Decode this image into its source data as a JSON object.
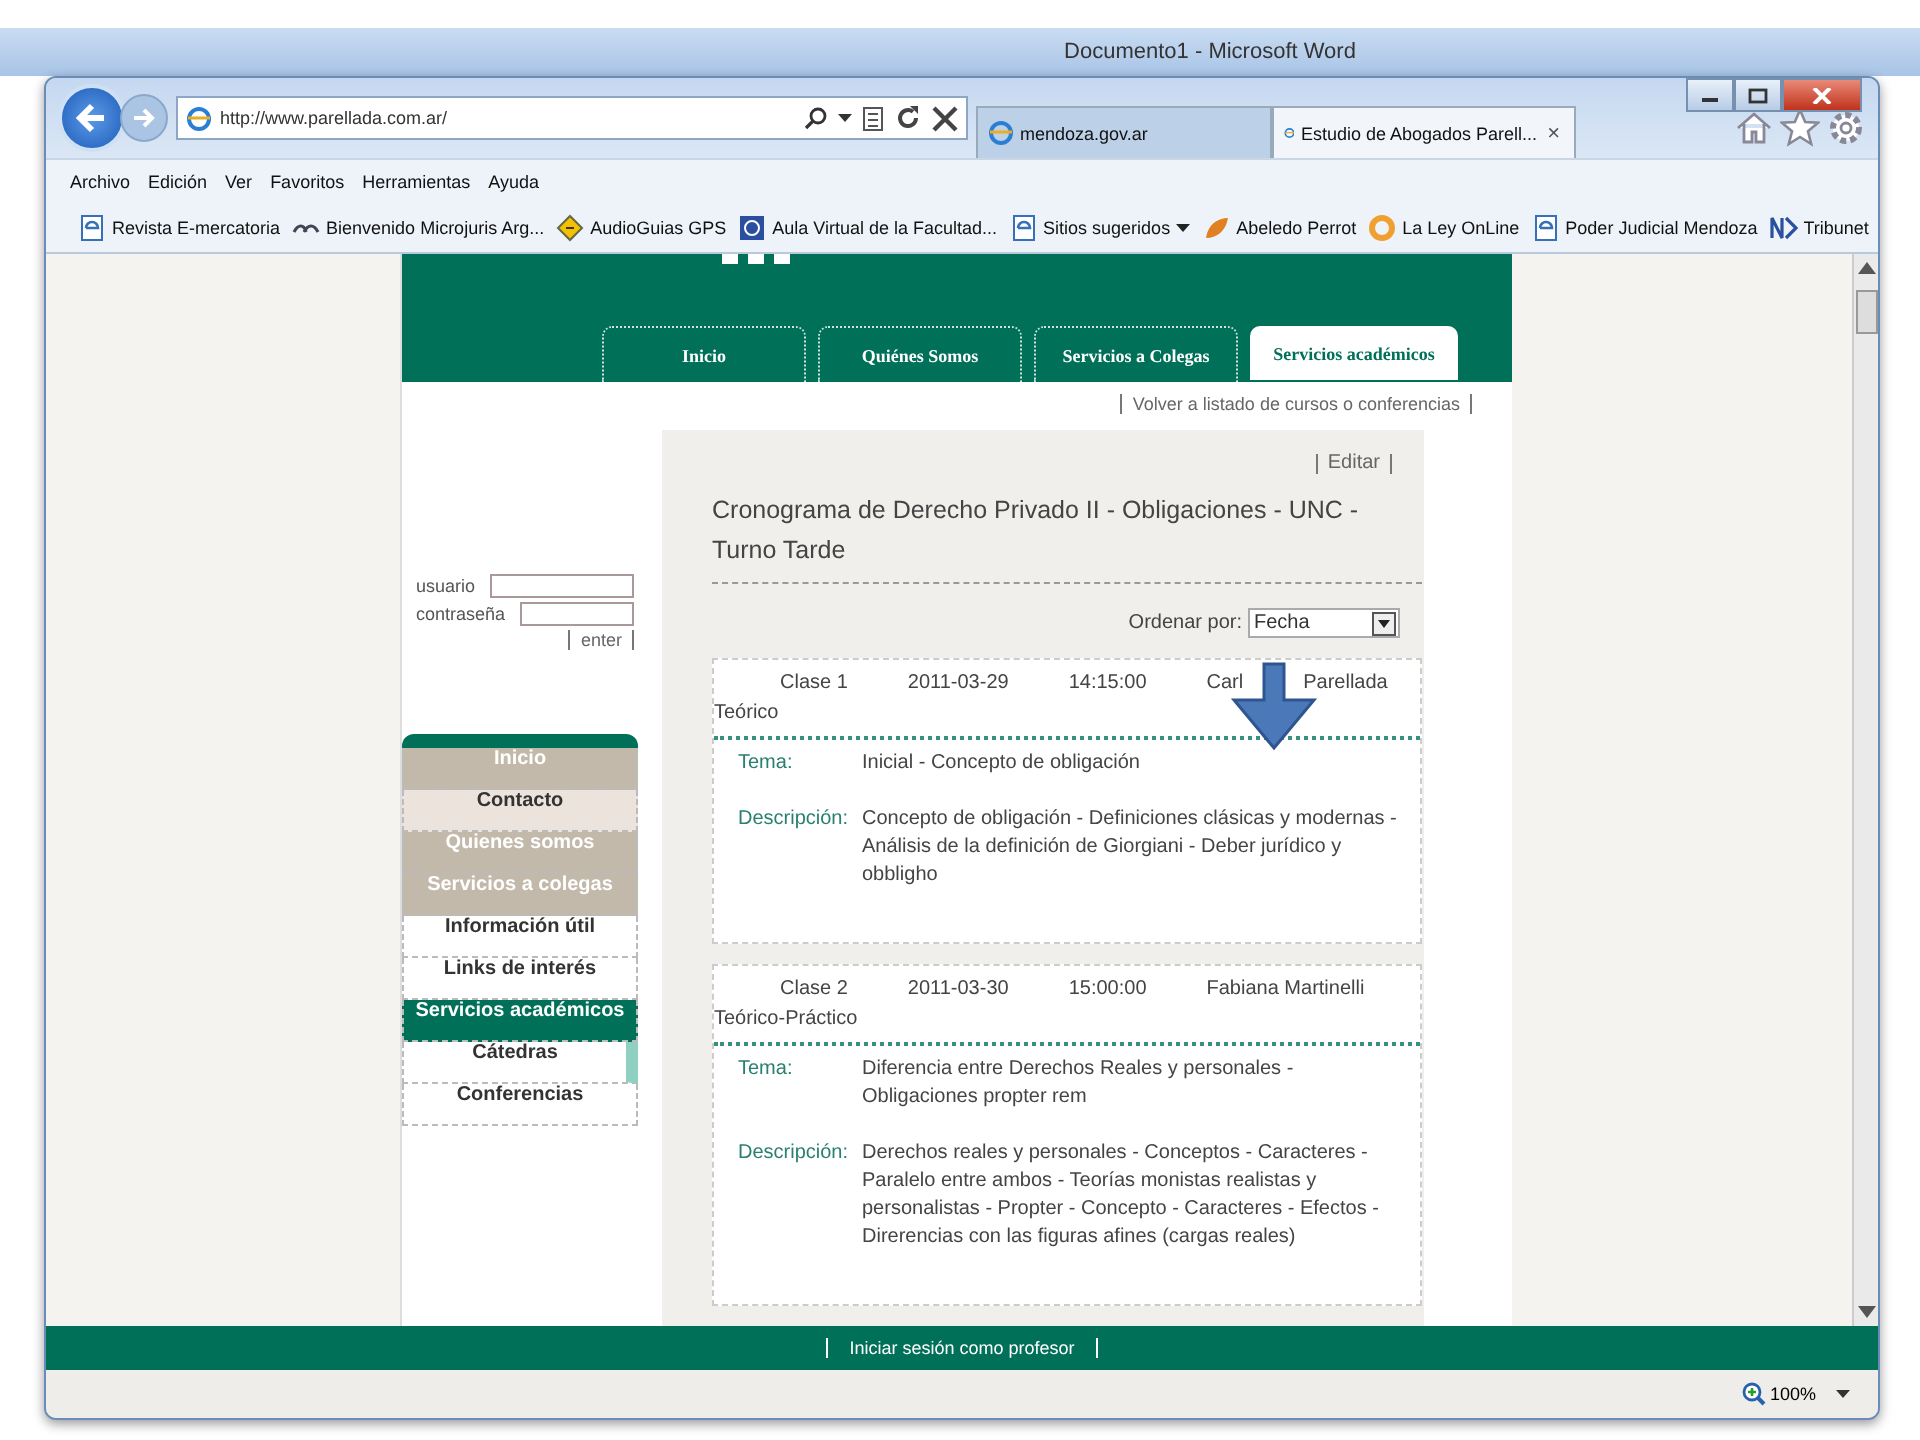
{
  "word_window": {
    "title": "Documento1 - Microsoft Word"
  },
  "browser": {
    "address": "http://www.parellada.com.ar/",
    "tabs": [
      {
        "label": "mendoza.gov.ar",
        "selected": false
      },
      {
        "label": "Estudio de Abogados Parell...",
        "selected": true,
        "close": "×"
      }
    ],
    "menu": [
      "Archivo",
      "Edición",
      "Ver",
      "Favoritos",
      "Herramientas",
      "Ayuda"
    ],
    "favorites": [
      {
        "label": "Revista E-mercatoria",
        "kind": "page"
      },
      {
        "label": "Bienvenido Microjuris Arg...",
        "kind": "mj"
      },
      {
        "label": "AudioGuias GPS",
        "kind": "diamond"
      },
      {
        "label": "Aula Virtual de la Facultad...",
        "kind": "square"
      },
      {
        "label": "Sitios sugeridos",
        "kind": "page",
        "dropdown": true
      },
      {
        "label": "Abeledo Perrot",
        "kind": "leaf"
      },
      {
        "label": "La Ley OnLine",
        "kind": "ring"
      },
      {
        "label": "Poder Judicial Mendoza",
        "kind": "page"
      },
      {
        "label": "Tribunet",
        "kind": "tn"
      }
    ],
    "zoom": "100%"
  },
  "site": {
    "nav_tabs": [
      {
        "label": "Inicio",
        "selected": false
      },
      {
        "label": "Quiénes Somos",
        "selected": false
      },
      {
        "label": "Servicios a Colegas",
        "selected": false
      },
      {
        "label": "Servicios académicos",
        "selected": true
      }
    ],
    "back_link": "Volver a listado de cursos o conferencias",
    "login": {
      "user_label": "usuario",
      "password_label": "contraseña",
      "enter": "enter"
    },
    "side_menu": [
      {
        "label": "Inicio",
        "kind": "main",
        "selected": false
      },
      {
        "label": "Contacto",
        "kind": "light",
        "selected": false
      },
      {
        "label": "Quienes somos",
        "kind": "main",
        "selected": false
      },
      {
        "label": "Servicios a colegas",
        "kind": "main",
        "selected": false
      },
      {
        "label": "Información útil",
        "kind": "plain",
        "selected": false
      },
      {
        "label": "Links de interés",
        "kind": "plain",
        "selected": false
      },
      {
        "label": "Servicios académicos",
        "kind": "plain",
        "selected": true
      },
      {
        "label": "Cátedras",
        "kind": "sub",
        "selected": false
      },
      {
        "label": "Conferencias",
        "kind": "plain",
        "selected": false
      }
    ],
    "edit_link": "Editar",
    "title": "Cronograma de Derecho Privado II - Obligaciones - UNC - Turno Tarde",
    "sort": {
      "label": "Ordenar por:",
      "value": "Fecha"
    },
    "classes": [
      {
        "fields": [
          "Clase 1",
          "2011-03-29",
          "14:15:00",
          "Carl",
          "Parellada",
          "Teórico"
        ],
        "topic_label": "Tema:",
        "topic": "Inicial - Concepto de obligación",
        "description_label": "Descripción:",
        "description": "Concepto de obligación - Definiciones clásicas y modernas - Análisis de la definición de Giorgiani - Deber jurídico y obbligho"
      },
      {
        "fields": [
          "Clase 2",
          "2011-03-30",
          "15:00:00",
          "Fabiana Martinelli",
          "Teórico-Práctico"
        ],
        "topic_label": "Tema:",
        "topic": "Diferencia entre Derechos Reales y personales - Obligaciones propter rem",
        "description_label": "Descripción:",
        "description": "Derechos reales y personales - Conceptos - Caracteres - Paralelo entre ambos - Teorías monistas realistas y personalistas - Propter - Concepto - Caracteres - Efectos - Direrencias con las figuras afines (cargas reales)"
      }
    ],
    "footer_link": "Iniciar sesión como profesor"
  }
}
